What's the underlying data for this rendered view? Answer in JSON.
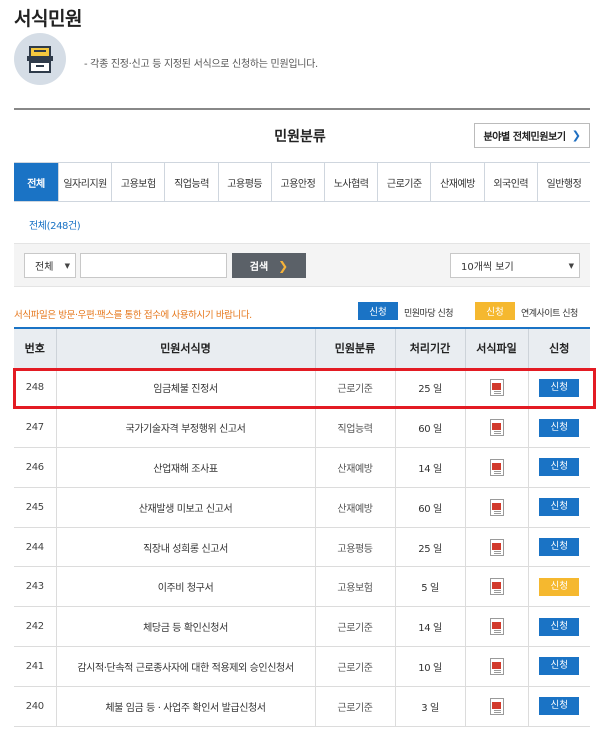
{
  "page": {
    "title": "서식민원",
    "intro": "- 각종 진정·신고 등 지정된 서식으로 신청하는 민원입니다."
  },
  "icons": {
    "intro": "archive-box-icon",
    "file": "document-file-icon",
    "chevron": "chevron-right-icon",
    "dropdown": "triangle-down-icon"
  },
  "section": {
    "title": "민원분류",
    "all_button": "분야별 전체민원보기",
    "all_button_chevron": "❯"
  },
  "tabs": [
    "전체",
    "일자리지원",
    "고용보험",
    "직업능력",
    "고용평등",
    "고용안정",
    "노사협력",
    "근로기준",
    "산재예방",
    "외국인력",
    "일반행정"
  ],
  "filter": {
    "count_label": "전체(248건)",
    "scope_value": "전체",
    "search_value": "",
    "search_button": "검색",
    "search_chevron": "❯",
    "page_size_value": "10개씩 보기",
    "dropdown_arrow": "▼"
  },
  "notice": "서식파일은 방문·우편·팩스를 통한 접수에 사용하시기 바랍니다.",
  "legend": {
    "blue_label": "신청",
    "blue_text": "민원마당 신청",
    "yellow_label": "신청",
    "yellow_text": "연계사이트 신청"
  },
  "colors": {
    "accent": "#1a73c5",
    "yellow": "#f5b82f",
    "notice": "#e6781d",
    "highlight": "#e31b23"
  },
  "table": {
    "headers": [
      "번호",
      "민원서식명",
      "민원분류",
      "처리기간",
      "서식파일",
      "신청"
    ],
    "rows": [
      {
        "no": "248",
        "name": "임금체불 진정서",
        "category": "근로기준",
        "period": "25 일",
        "apply": "신청",
        "apply_type": "blue",
        "highlighted": true
      },
      {
        "no": "247",
        "name": "국가기술자격 부정행위 신고서",
        "category": "직업능력",
        "period": "60 일",
        "apply": "신청",
        "apply_type": "blue"
      },
      {
        "no": "246",
        "name": "산업재해 조사표",
        "category": "산재예방",
        "period": "14 일",
        "apply": "신청",
        "apply_type": "blue"
      },
      {
        "no": "245",
        "name": "산재발생 미보고 신고서",
        "category": "산재예방",
        "period": "60 일",
        "apply": "신청",
        "apply_type": "blue"
      },
      {
        "no": "244",
        "name": "직장내 성희롱 신고서",
        "category": "고용평등",
        "period": "25 일",
        "apply": "신청",
        "apply_type": "blue"
      },
      {
        "no": "243",
        "name": "이주비 청구서",
        "category": "고용보험",
        "period": "5 일",
        "apply": "신청",
        "apply_type": "yellow"
      },
      {
        "no": "242",
        "name": "체당금 등 확인신청서",
        "category": "근로기준",
        "period": "14 일",
        "apply": "신청",
        "apply_type": "blue"
      },
      {
        "no": "241",
        "name": "감시적·단속적 근로종사자에 대한 적용제외 승인신청서",
        "category": "근로기준",
        "period": "10 일",
        "apply": "신청",
        "apply_type": "blue"
      },
      {
        "no": "240",
        "name": "체불 임금 등 · 사업주 확인서 발급신청서",
        "category": "근로기준",
        "period": "3 일",
        "apply": "신청",
        "apply_type": "blue"
      }
    ]
  }
}
